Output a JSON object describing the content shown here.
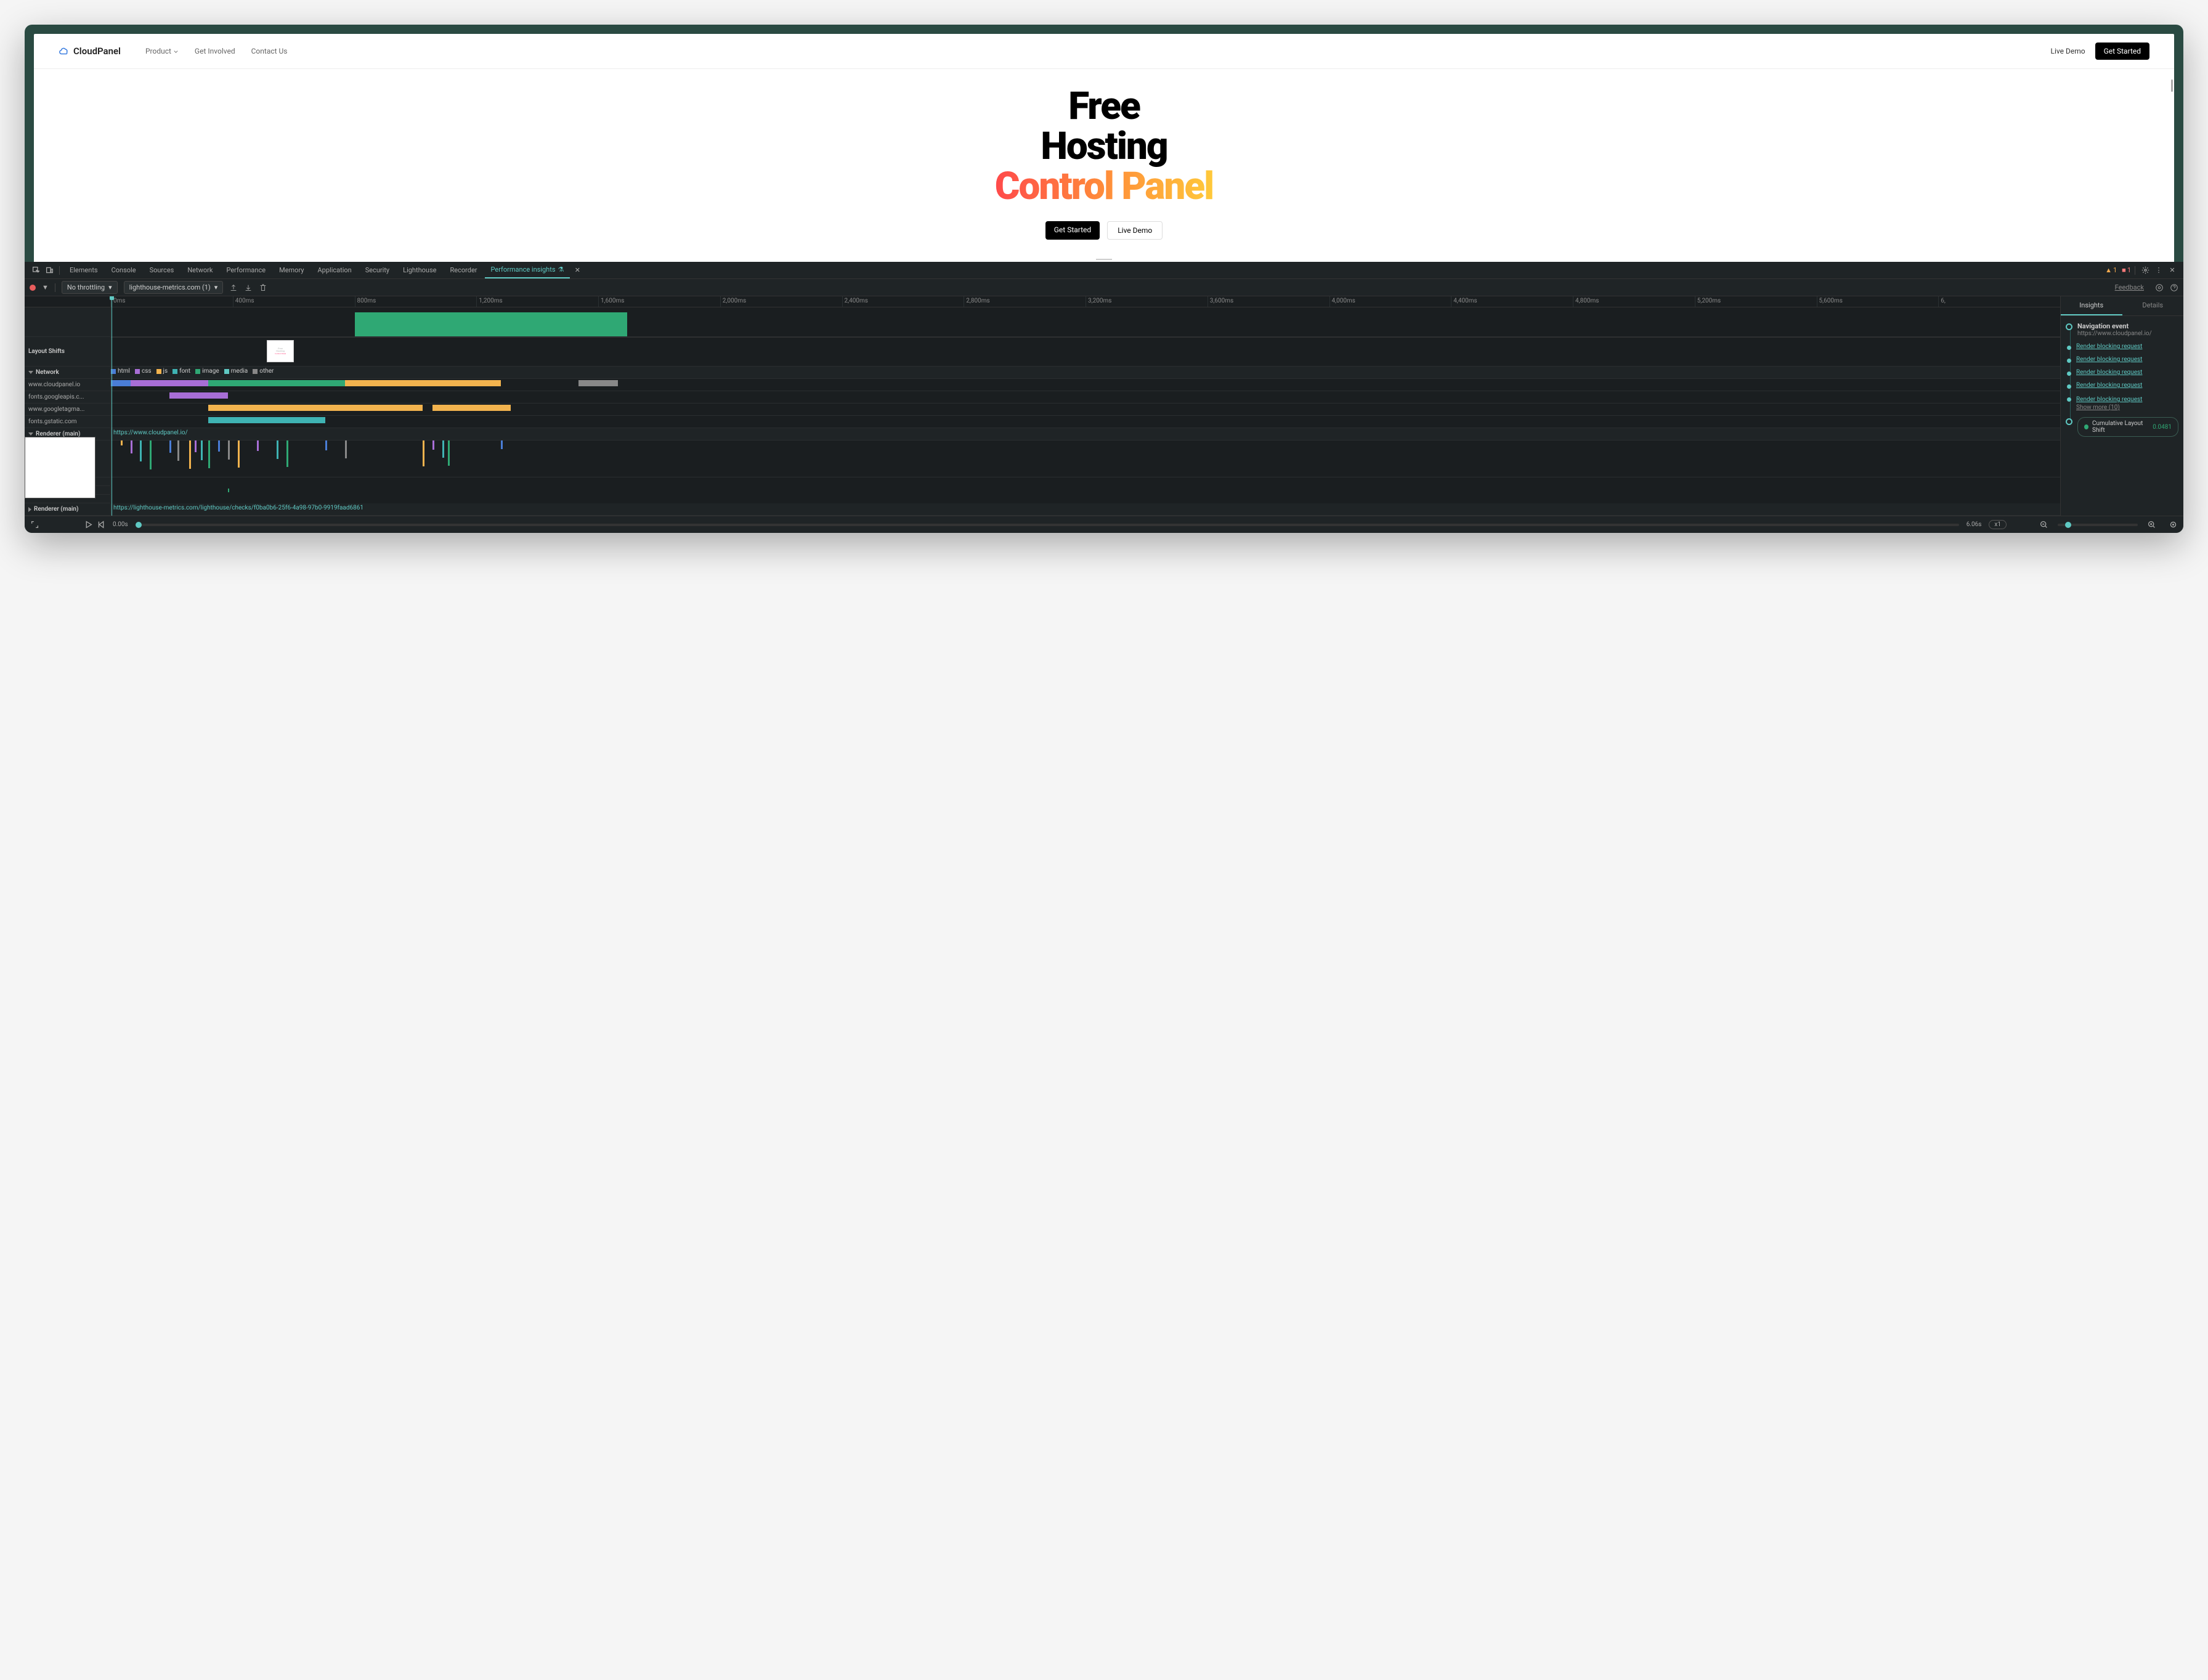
{
  "webpage": {
    "brand": "CloudPanel",
    "nav": {
      "product": "Product",
      "get_involved": "Get Involved",
      "contact": "Contact Us",
      "live_demo": "Live Demo",
      "get_started": "Get Started"
    },
    "hero": {
      "line1": "Free",
      "line2": "Hosting",
      "line3": "Control Panel",
      "cta1": "Get Started",
      "cta2": "Live Demo"
    }
  },
  "tabs": {
    "elements": "Elements",
    "console": "Console",
    "sources": "Sources",
    "network": "Network",
    "performance": "Performance",
    "memory": "Memory",
    "application": "Application",
    "security": "Security",
    "lighthouse": "Lighthouse",
    "recorder": "Recorder",
    "perf_insights": "Performance insights",
    "warn_count": "1",
    "err_count": "1"
  },
  "toolbar": {
    "throttle": "No throttling",
    "measure": "lighthouse-metrics.com (1)",
    "feedback": "Feedback"
  },
  "ruler": [
    "0ms",
    "400ms",
    "800ms",
    "1,200ms",
    "1,600ms",
    "2,000ms",
    "2,400ms",
    "2,800ms",
    "3,200ms",
    "3,600ms",
    "4,000ms",
    "4,400ms",
    "4,800ms",
    "5,200ms",
    "5,600ms",
    "6,"
  ],
  "tracks": {
    "layout_shifts": "Layout Shifts",
    "network": "Network",
    "renderer_main": "Renderer (main)",
    "main": "Main",
    "net_rows": [
      "www.cloudpanel.io",
      "fonts.googleapis.c...",
      "www.googletagma...",
      "fonts.gstatic.com"
    ],
    "legend": [
      {
        "label": "html",
        "color": "#4a7dd6"
      },
      {
        "label": "css",
        "color": "#a86ed6"
      },
      {
        "label": "js",
        "color": "#f2b34e"
      },
      {
        "label": "font",
        "color": "#3fb3b3"
      },
      {
        "label": "image",
        "color": "#2fa874"
      },
      {
        "label": "media",
        "color": "#5fc9c3"
      },
      {
        "label": "other",
        "color": "#888"
      }
    ],
    "renderer_url": "https://www.cloudpanel.io/",
    "renderer2_url": "https://lighthouse-metrics.com/lighthouse/checks/f0ba0b6-25f6-4a98-97b0-9919faad6861"
  },
  "insights": {
    "tab_insights": "Insights",
    "tab_details": "Details",
    "nav_event": "Navigation event",
    "nav_url": "https://www.cloudpanel.io/",
    "render_block": "Render blocking request",
    "show_more": "Show more (10)",
    "cls_label": "Cumulative Layout Shift",
    "cls_value": "0.0481"
  },
  "bottom": {
    "start": "0.00s",
    "end": "6.06s",
    "speed": "x1"
  },
  "colors": {
    "teal": "#5fc9c3",
    "green": "#2fa874"
  }
}
